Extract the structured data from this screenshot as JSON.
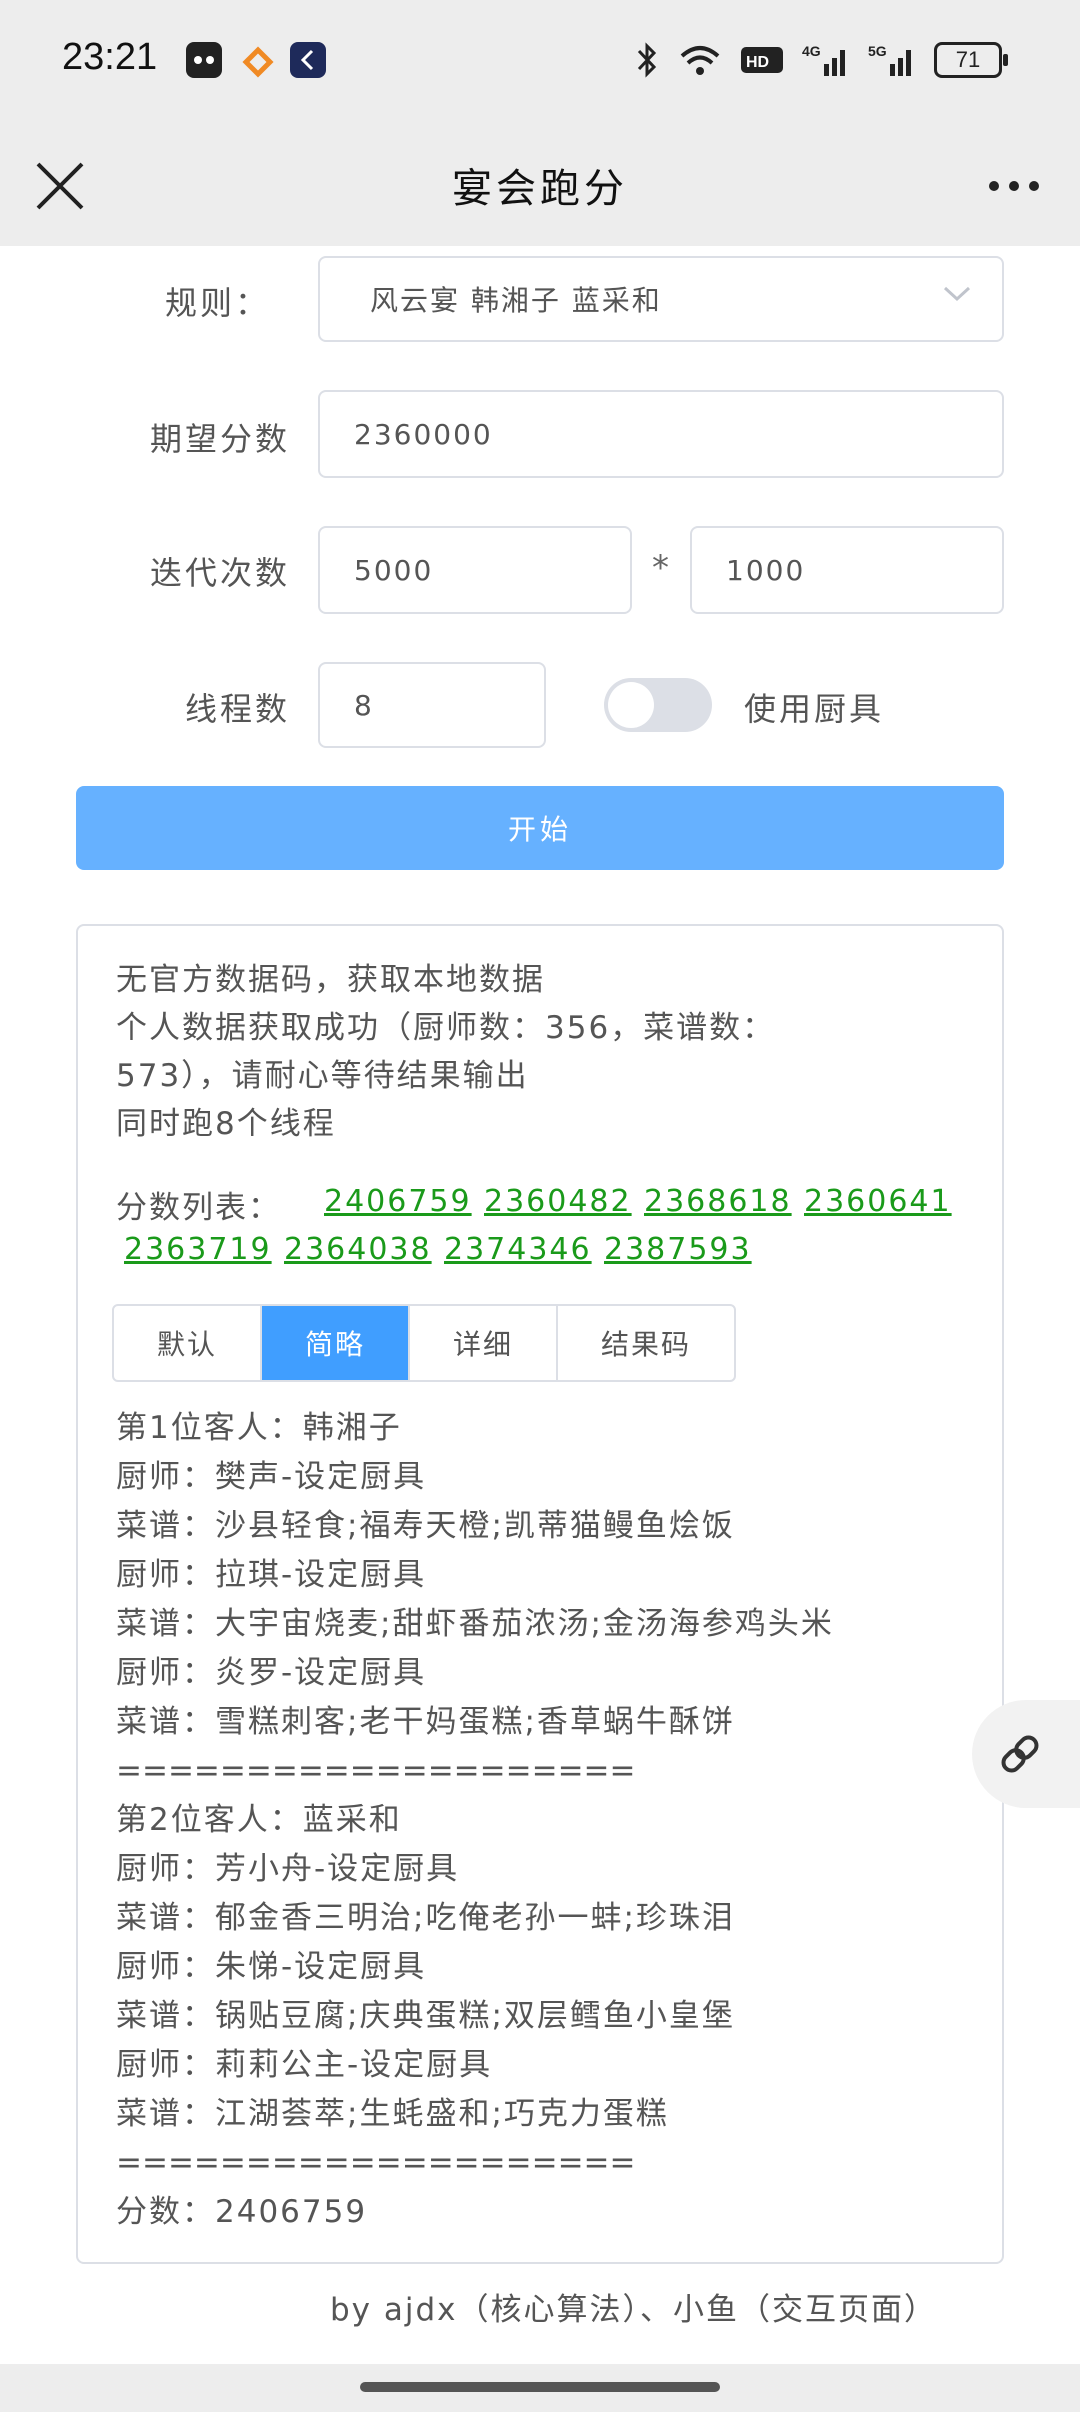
{
  "status_bar": {
    "time": "23:21",
    "battery": "71",
    "network_labels": [
      "HD2",
      "4G",
      "5G"
    ]
  },
  "header": {
    "title": "宴会跑分"
  },
  "form": {
    "rule_label": "规则：",
    "rule_value": "风云宴 韩湘子 蓝采和",
    "expected_label": "期望分数",
    "expected_value": "2360000",
    "iter_label": "迭代次数",
    "iter_value_1": "5000",
    "iter_multiply": "*",
    "iter_value_2": "1000",
    "threads_label": "线程数",
    "threads_value": "8",
    "use_tools_label": "使用厨具",
    "use_tools_on": false,
    "start_label": "开始"
  },
  "output": {
    "messages": [
      "无官方数据码，获取本地数据",
      "个人数据获取成功（厨师数：356，菜谱数：",
      "573），请耐心等待结果输出",
      "同时跑8个线程"
    ],
    "scores_label": "分数列表：",
    "scores": [
      "2406759",
      "2360482",
      "2368618",
      "2360641",
      "2363719",
      "2364038",
      "2374346",
      "2387593"
    ],
    "tabs": [
      "默认",
      "简略",
      "详细",
      "结果码"
    ],
    "active_tab": "简略",
    "result_lines": [
      "第1位客人：韩湘子",
      "厨师：樊声-设定厨具",
      "菜谱：沙县轻食;福寿天橙;凯蒂猫鳗鱼烩饭",
      "厨师：拉琪-设定厨具",
      "菜谱：大宇宙烧麦;甜虾番茄浓汤;金汤海参鸡头米",
      "厨师：炎罗-设定厨具",
      "菜谱：雪糕刺客;老干妈蛋糕;香草蜗牛酥饼",
      "====================",
      "第2位客人：蓝采和",
      "厨师：芳小舟-设定厨具",
      "菜谱：郁金香三明治;吃俺老孙一蚌;珍珠泪",
      "厨师：朱悌-设定厨具",
      "菜谱：锅贴豆腐;庆典蛋糕;双层鳕鱼小皇堡",
      "厨师：莉莉公主-设定厨具",
      "菜谱：江湖荟萃;生蚝盛和;巧克力蛋糕",
      "====================",
      "分数：2406759"
    ]
  },
  "footer": {
    "credit": "by ajdx（核心算法）、小鱼（交互页面）"
  }
}
